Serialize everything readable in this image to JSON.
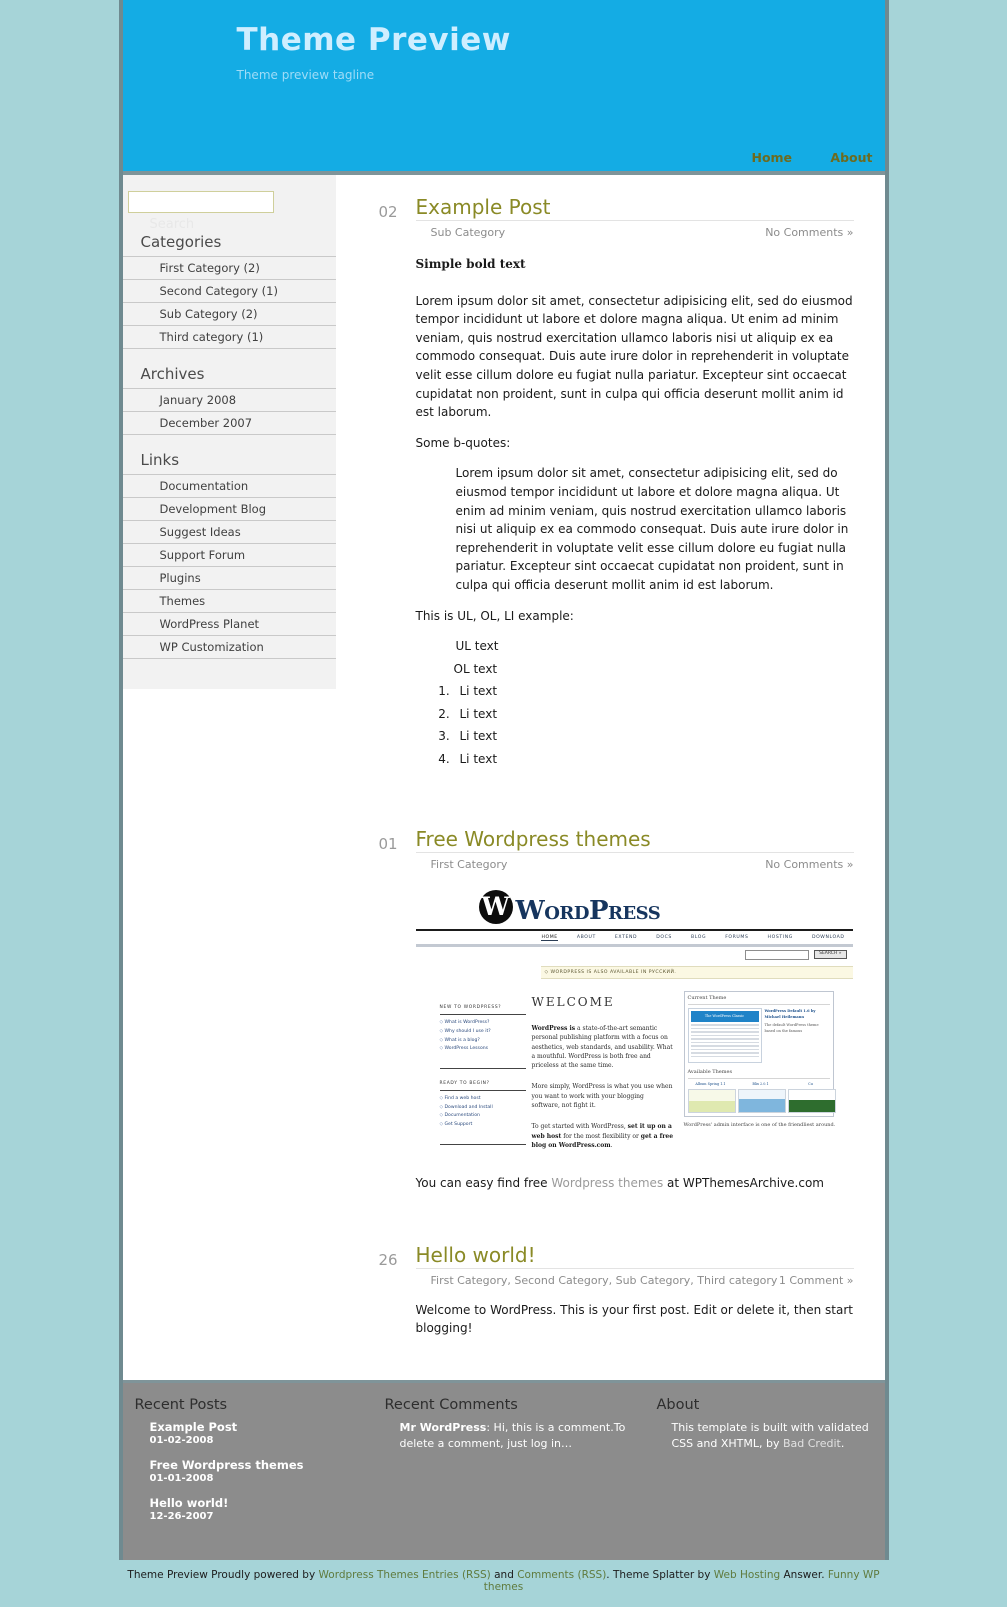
{
  "header": {
    "title": "Theme Preview",
    "tagline": "Theme preview tagline",
    "nav": [
      {
        "label": "Home"
      },
      {
        "label": "About"
      }
    ]
  },
  "sidebar": {
    "search": {
      "value": "",
      "placeholder": "",
      "label": "Search"
    },
    "widgets": [
      {
        "title": "Categories",
        "items": [
          {
            "label": "First Category (2)"
          },
          {
            "label": "Second Category (1)"
          },
          {
            "label": "Sub Category (2)"
          },
          {
            "label": "Third category (1)"
          }
        ]
      },
      {
        "title": "Archives",
        "items": [
          {
            "label": "January 2008"
          },
          {
            "label": "December 2007"
          }
        ]
      },
      {
        "title": "Links",
        "items": [
          {
            "label": "Documentation"
          },
          {
            "label": "Development Blog"
          },
          {
            "label": "Suggest Ideas"
          },
          {
            "label": "Support Forum"
          },
          {
            "label": "Plugins"
          },
          {
            "label": "Themes"
          },
          {
            "label": "WordPress Planet"
          },
          {
            "label": "WP Customization"
          }
        ]
      }
    ]
  },
  "posts": [
    {
      "date_day": "02",
      "title": "Example Post",
      "categories": "Sub Category",
      "comments": "No Comments »",
      "bold_line": "Simple bold text",
      "paragraph1": "Lorem ipsum dolor sit amet, consectetur adipisicing elit, sed do eiusmod tempor incididunt ut labore et dolore magna aliqua. Ut enim ad minim veniam, quis nostrud exercitation ullamco laboris nisi ut aliquip ex ea commodo consequat. Duis aute irure dolor in reprehenderit in voluptate velit esse cillum dolore eu fugiat nulla pariatur. Excepteur sint occaecat cupidatat non proident, sunt in culpa qui officia deserunt mollit anim id est laborum.",
      "quote_intro": "Some b-quotes:",
      "blockquote": "Lorem ipsum dolor sit amet, consectetur adipisicing elit, sed do eiusmod tempor incididunt ut labore et dolore magna aliqua. Ut enim ad minim veniam, quis nostrud exercitation ullamco laboris nisi ut aliquip ex ea commodo consequat. Duis aute irure dolor in reprehenderit in voluptate velit esse cillum dolore eu fugiat nulla pariatur. Excepteur sint occaecat cupidatat non proident, sunt in culpa qui officia deserunt mollit anim id est laborum.",
      "list_intro": "This is UL, OL, LI example:",
      "ul_item": "UL text",
      "ol_label": "OL text",
      "ol_items": [
        "Li text",
        "Li text",
        "Li text",
        "Li text"
      ]
    },
    {
      "date_day": "01",
      "title": "Free Wordpress themes",
      "categories": "First Category",
      "comments": "No Comments »",
      "caption_before": "You can easy find free ",
      "caption_link": "Wordpress themes",
      "caption_after": " at WPThemesArchive.com"
    },
    {
      "date_day": "26",
      "title": "Hello world!",
      "categories": "First Category, Second Category, Sub Category, Third category",
      "comments": "1 Comment »",
      "body": "Welcome to WordPress. This is your first post. Edit or delete it, then start blogging!"
    }
  ],
  "wp_screenshot": {
    "brand_mark": "W",
    "wordmark": "WordPress",
    "nav": [
      "HOME",
      "ABOUT",
      "EXTEND",
      "DOCS",
      "BLOG",
      "FORUMS",
      "HOSTING",
      "DOWNLOAD"
    ],
    "active_nav": "HOME",
    "search_button": "SEARCH »",
    "banner": "◇ WORDPRESS IS ALSO AVAILABLE IN РУССКИЙ.",
    "side1_heading": "NEW TO WORDPRESS?",
    "side1_items": [
      "What is WordPress?",
      "Why should I use it?",
      "What is a blog?",
      "WordPress Lessons"
    ],
    "side2_heading": "READY TO BEGIN?",
    "side2_items": [
      "Find a web host",
      "Download and Install",
      "Documentation",
      "Get Support"
    ],
    "welcome_heading": "WELCOME",
    "para1_bold": "WordPress is",
    "para1": " a state-of-the-art semantic personal publishing platform with a focus on aesthetics, web standards, and usability. What a mouthful. WordPress is both free and priceless at the same time.",
    "para2": "More simply, WordPress is what you use when you want to work with your blogging software, not fight it.",
    "para3_a": "To get started with WordPress, ",
    "para3_b": "set it up on a web host",
    "para3_c": " for the most flexibility or ",
    "para3_d": "get a free blog on WordPress.com",
    "para3_e": ".",
    "thumb_heading": "Current Theme",
    "thumb_bar": "The WordPress Classic",
    "thumb_title": "WordPress Default 1.6 by Michael Heilemann",
    "thumb_desc": "The default WordPress theme based on the famous",
    "avail_heading": "Available Themes",
    "avail_titles": [
      "Album Spring 1.1",
      "Blix 2.0.1",
      "Cu"
    ],
    "caption": "WordPress' admin interface is one of the friendliest around."
  },
  "footer": {
    "columns": [
      {
        "title": "Recent Posts",
        "posts": [
          {
            "title": "Example Post",
            "date": "01-02-2008"
          },
          {
            "title": "Free Wordpress themes",
            "date": "01-01-2008"
          },
          {
            "title": "Hello world!",
            "date": "12-26-2007"
          }
        ]
      },
      {
        "title": "Recent Comments",
        "comment_author": "Mr WordPress",
        "comment_text": ": Hi, this is a comment.To delete a comment, just log in…"
      },
      {
        "title": "About",
        "about_before": "This template is built with validated CSS and XHTML, by ",
        "about_link": "Bad Credit",
        "about_after": "."
      }
    ]
  },
  "credit": {
    "t1": "Theme Preview Proudly powered by ",
    "l1": "Wordpress Themes",
    "t2": " ",
    "l2": "Entries (RSS)",
    "t3": " and ",
    "l3": "Comments (RSS)",
    "t4": ". Theme Splatter by ",
    "l4": "Web Hosting",
    "t5": " Answer. ",
    "l5": "Funny WP themes"
  }
}
